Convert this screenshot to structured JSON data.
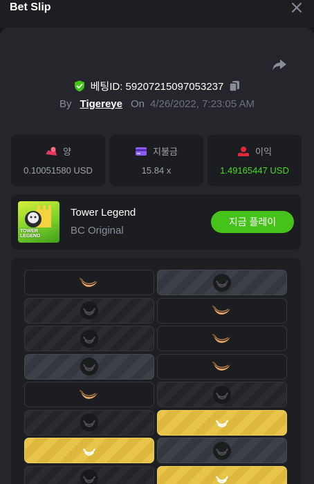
{
  "header": {
    "title": "Bet Slip"
  },
  "bet": {
    "id_text": "베팅ID: 59207215097053237",
    "by_label": "By",
    "user": "Tigereye",
    "on_label": "On",
    "date": "4/26/2022, 7:23:05 AM"
  },
  "stats": [
    {
      "label": "양",
      "value": "0.10051580 USD",
      "icon": "coins-icon"
    },
    {
      "label": "지불금",
      "value": "15.84 x",
      "icon": "card-icon"
    },
    {
      "label": "이익",
      "value": "1.49165447 USD",
      "icon": "hand-coin-icon"
    }
  ],
  "game": {
    "name": "Tower Legend",
    "sub": "BC Original",
    "play_label": "지금 플레이",
    "thumb_text_1": "TOWER",
    "thumb_text_2": "LEGEND"
  },
  "board": {
    "rows": [
      [
        "banana",
        "gray"
      ],
      [
        "empty",
        "banana"
      ],
      [
        "empty",
        "banana"
      ],
      [
        "gray",
        "banana"
      ],
      [
        "banana",
        "empty"
      ],
      [
        "empty",
        "gold"
      ],
      [
        "gold",
        "gray"
      ],
      [
        "empty",
        "gold"
      ]
    ]
  },
  "colors": {
    "accent": "#45c31b",
    "profit": "#4cd82a",
    "gold": "#e8c54a"
  }
}
